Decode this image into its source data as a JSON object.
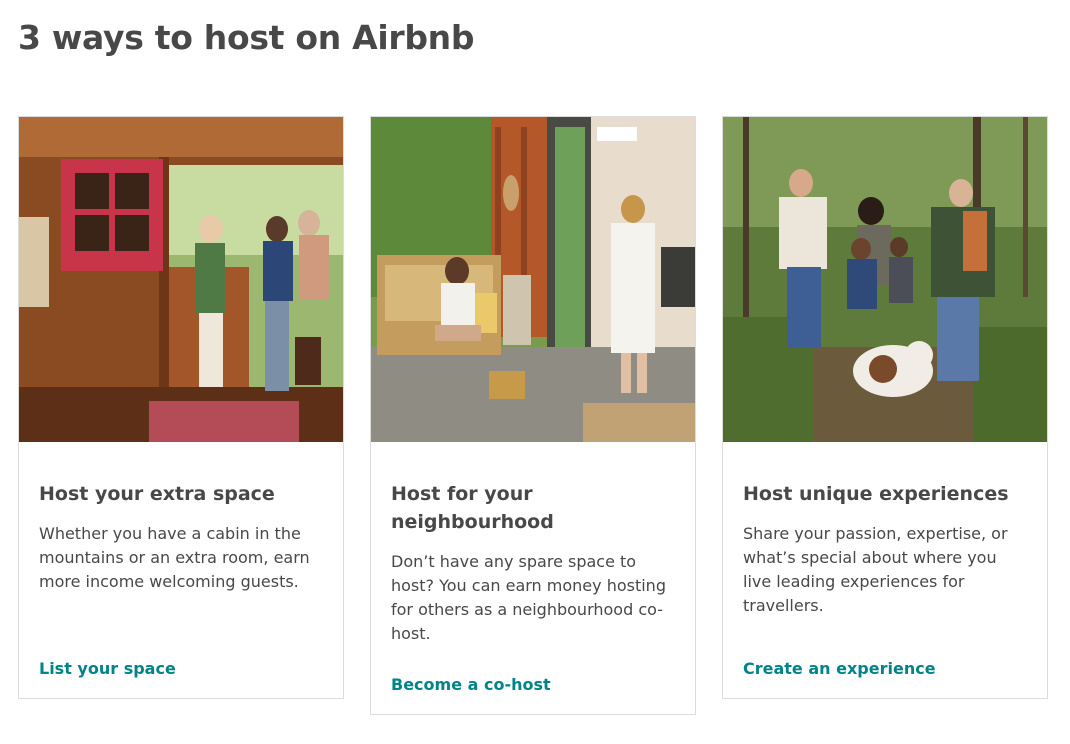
{
  "page": {
    "title": "3 ways to host on Airbnb"
  },
  "cards": [
    {
      "title": "Host your extra space",
      "description": "Whether you have a cabin in the mountains or an extra room, earn more income welcoming guests.",
      "link": "List your space",
      "image": "hosts-welcoming-guests-at-cabin-door"
    },
    {
      "title": "Host for your neighbourhood",
      "description": "Don’t have any spare space to host? You can earn money hosting for others as a neighbourhood co-host.",
      "link": "Become a co-host",
      "image": "women-on-porch-with-bench"
    },
    {
      "title": "Host unique experiences",
      "description": "Share your passion, expertise, or what’s special about where you live leading experiences for travellers.",
      "link": "Create an experience",
      "image": "family-hiking-in-forest-with-dog"
    }
  ],
  "colors": {
    "link": "#008489",
    "text": "#484848",
    "border": "#dcdcdc"
  }
}
